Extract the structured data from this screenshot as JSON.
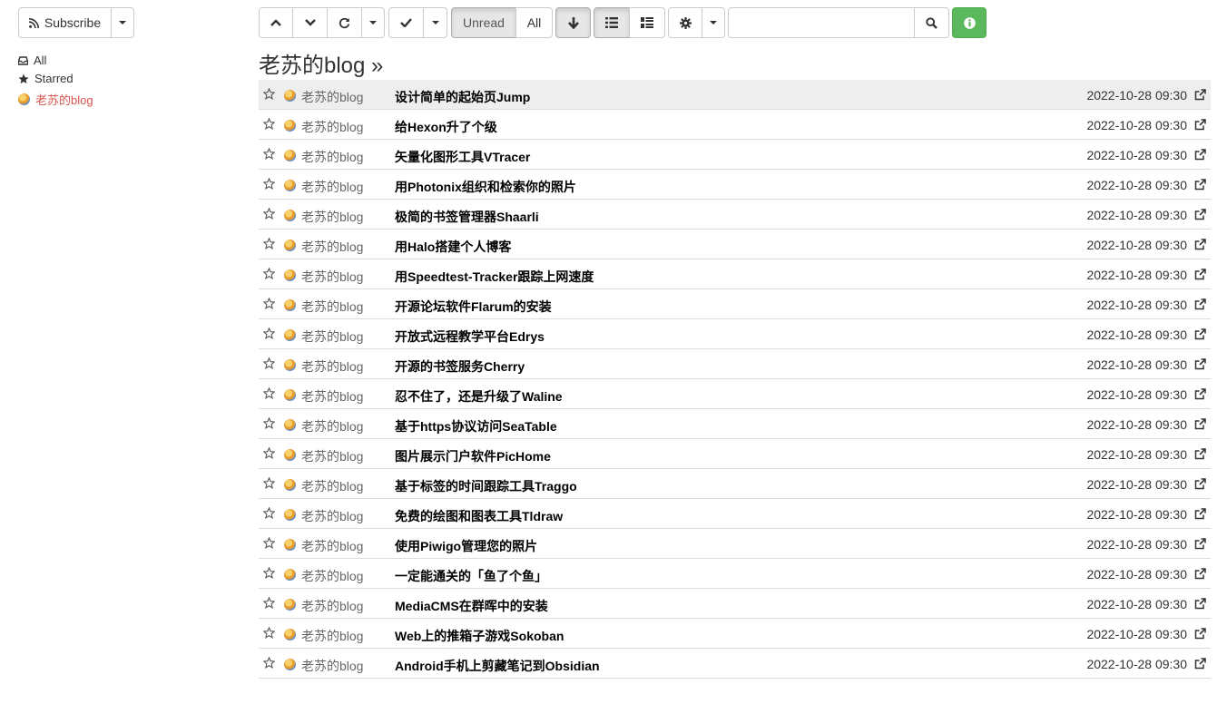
{
  "subscribe": {
    "label": "Subscribe"
  },
  "toolbar": {
    "filter_unread": "Unread",
    "filter_all": "All",
    "search_placeholder": ""
  },
  "sidebar": {
    "items": [
      {
        "label": "All",
        "icon": "inbox-icon"
      },
      {
        "label": "Starred",
        "icon": "star-icon"
      },
      {
        "label": "老苏的blog",
        "icon": "feed-favicon"
      }
    ]
  },
  "feed": {
    "title": "老苏的blog »"
  },
  "colors": {
    "success": "#5cb85c",
    "current": "#d9534f"
  },
  "entries": [
    {
      "source": "老苏的blog",
      "title": "设计简单的起始页Jump",
      "date": "2022-10-28 09:30"
    },
    {
      "source": "老苏的blog",
      "title": "给Hexon升了个级",
      "date": "2022-10-28 09:30"
    },
    {
      "source": "老苏的blog",
      "title": "矢量化图形工具VTracer",
      "date": "2022-10-28 09:30"
    },
    {
      "source": "老苏的blog",
      "title": "用Photonix组织和检索你的照片",
      "date": "2022-10-28 09:30"
    },
    {
      "source": "老苏的blog",
      "title": "极简的书签管理器Shaarli",
      "date": "2022-10-28 09:30"
    },
    {
      "source": "老苏的blog",
      "title": "用Halo搭建个人博客",
      "date": "2022-10-28 09:30"
    },
    {
      "source": "老苏的blog",
      "title": "用Speedtest-Tracker跟踪上网速度",
      "date": "2022-10-28 09:30"
    },
    {
      "source": "老苏的blog",
      "title": "开源论坛软件Flarum的安装",
      "date": "2022-10-28 09:30"
    },
    {
      "source": "老苏的blog",
      "title": "开放式远程教学平台Edrys",
      "date": "2022-10-28 09:30"
    },
    {
      "source": "老苏的blog",
      "title": "开源的书签服务Cherry",
      "date": "2022-10-28 09:30"
    },
    {
      "source": "老苏的blog",
      "title": "忍不住了，还是升级了Waline",
      "date": "2022-10-28 09:30"
    },
    {
      "source": "老苏的blog",
      "title": "基于https协议访问SeaTable",
      "date": "2022-10-28 09:30"
    },
    {
      "source": "老苏的blog",
      "title": "图片展示门户软件PicHome",
      "date": "2022-10-28 09:30"
    },
    {
      "source": "老苏的blog",
      "title": "基于标签的时间跟踪工具Traggo",
      "date": "2022-10-28 09:30"
    },
    {
      "source": "老苏的blog",
      "title": "免费的绘图和图表工具Tldraw",
      "date": "2022-10-28 09:30"
    },
    {
      "source": "老苏的blog",
      "title": "使用Piwigo管理您的照片",
      "date": "2022-10-28 09:30"
    },
    {
      "source": "老苏的blog",
      "title": "一定能通关的「鱼了个鱼」",
      "date": "2022-10-28 09:30"
    },
    {
      "source": "老苏的blog",
      "title": "MediaCMS在群晖中的安装",
      "date": "2022-10-28 09:30"
    },
    {
      "source": "老苏的blog",
      "title": "Web上的推箱子游戏Sokoban",
      "date": "2022-10-28 09:30"
    },
    {
      "source": "老苏的blog",
      "title": "Android手机上剪藏笔记到Obsidian",
      "date": "2022-10-28 09:30"
    }
  ]
}
